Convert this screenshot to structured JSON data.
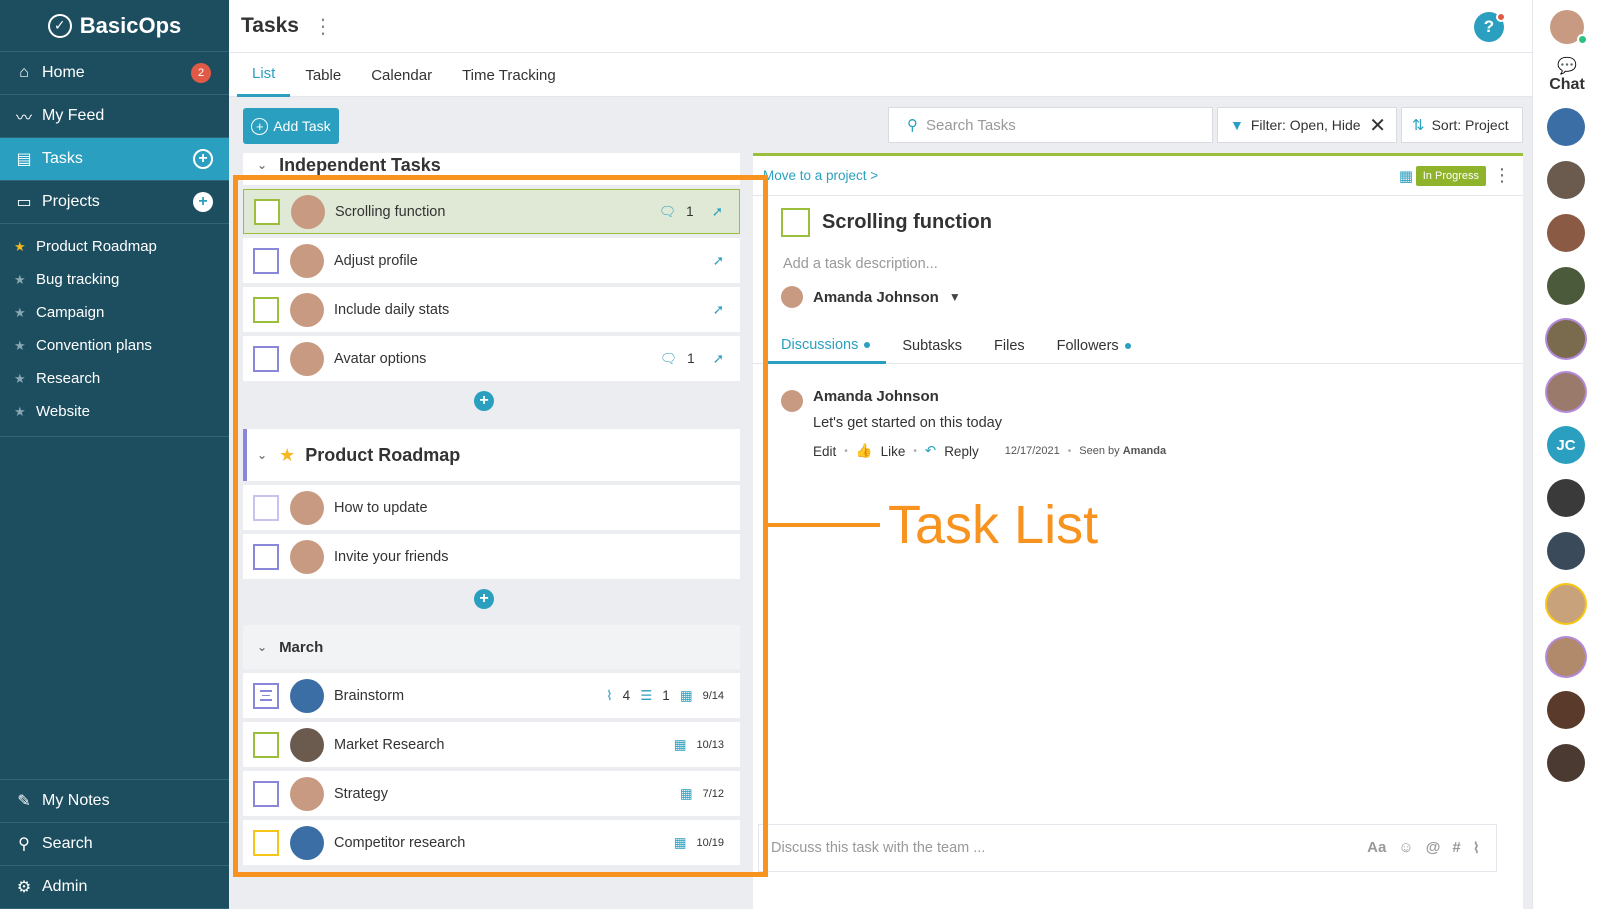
{
  "app": {
    "name": "BasicOps"
  },
  "sidebar": {
    "nav": [
      {
        "label": "Home",
        "icon": "home-icon",
        "glyph": "⌂",
        "badge": "2"
      },
      {
        "label": "My Feed",
        "icon": "pulse-icon",
        "glyph": "〰"
      },
      {
        "label": "Tasks",
        "icon": "clipboard-icon",
        "glyph": "▤"
      },
      {
        "label": "Projects",
        "icon": "folder-icon",
        "glyph": "▭"
      }
    ],
    "projects": [
      {
        "label": "Product Roadmap",
        "favorite": true
      },
      {
        "label": "Bug tracking",
        "favorite": false
      },
      {
        "label": "Campaign",
        "favorite": false
      },
      {
        "label": "Convention plans",
        "favorite": false
      },
      {
        "label": "Research",
        "favorite": false
      },
      {
        "label": "Website",
        "favorite": false
      }
    ],
    "bottom": [
      {
        "label": "My Notes",
        "icon": "pencil-icon",
        "glyph": "✎"
      },
      {
        "label": "Search",
        "icon": "search-icon",
        "glyph": "⚲"
      },
      {
        "label": "Admin",
        "icon": "gear-icon",
        "glyph": "⚙"
      }
    ]
  },
  "header": {
    "title": "Tasks",
    "help": "?"
  },
  "tabs": [
    {
      "label": "List",
      "active": true
    },
    {
      "label": "Table",
      "active": false
    },
    {
      "label": "Calendar",
      "active": false
    },
    {
      "label": "Time Tracking",
      "active": false
    }
  ],
  "toolbar": {
    "add_task": "Add Task",
    "search_placeholder": "Search Tasks",
    "filter_label": "Filter: Open, Hide",
    "sort_label": "Sort: Project"
  },
  "rail": {
    "chat_label": "Chat",
    "people": [
      {
        "bg": "#3a6ea5",
        "initials": ""
      },
      {
        "bg": "#6b5a4e",
        "initials": ""
      },
      {
        "bg": "#8a5a44",
        "initials": ""
      },
      {
        "bg": "#4a5a3a",
        "initials": ""
      },
      {
        "bg": "#7a6a4e",
        "initials": ""
      },
      {
        "bg": "#9a7a6a",
        "initials": ""
      },
      {
        "bg": "#2b9fbf",
        "initials": "JC"
      },
      {
        "bg": "#3a3a3a",
        "initials": ""
      },
      {
        "bg": "#3a4a5a",
        "initials": ""
      },
      {
        "bg": "#c8a27a",
        "initials": ""
      },
      {
        "bg": "#b08a6a",
        "initials": ""
      },
      {
        "bg": "#5a3a2a",
        "initials": ""
      },
      {
        "bg": "#4a3a32",
        "initials": ""
      }
    ]
  },
  "task_list": {
    "sections": [
      {
        "title": "Independent Tasks",
        "tasks": [
          {
            "name": "Scrolling function",
            "comments": "1",
            "selected": true,
            "box": "green"
          },
          {
            "name": "Adjust profile",
            "box": "purple"
          },
          {
            "name": "Include daily stats",
            "box": "green"
          },
          {
            "name": "Avatar options",
            "comments": "1",
            "box": "purple"
          }
        ]
      },
      {
        "title": "Product Roadmap",
        "tasks": [
          {
            "name": "How to update",
            "box": "light"
          },
          {
            "name": "Invite your friends",
            "box": "purple"
          }
        ]
      },
      {
        "title": "March",
        "tasks": [
          {
            "name": "Brainstorm",
            "attachments": "4",
            "subtasks": "1",
            "due": "9/14",
            "box": "lines"
          },
          {
            "name": "Market Research",
            "due": "10/13",
            "box": "green"
          },
          {
            "name": "Strategy",
            "due": "7/12",
            "box": "purple"
          },
          {
            "name": "Competitor research",
            "due": "10/19",
            "box": "yellow"
          }
        ]
      }
    ]
  },
  "detail": {
    "move_link": "Move to a project >",
    "status": "In Progress",
    "title": "Scrolling function",
    "description_placeholder": "Add a task description...",
    "assignee": "Amanda Johnson",
    "tabs": [
      {
        "label": "Discussions",
        "active": true,
        "dot": true
      },
      {
        "label": "Subtasks",
        "active": false,
        "dot": false
      },
      {
        "label": "Files",
        "active": false,
        "dot": false
      },
      {
        "label": "Followers",
        "active": false,
        "dot": true
      }
    ],
    "comment": {
      "author": "Amanda Johnson",
      "text": "Let's get started on this today",
      "edit": "Edit",
      "like": "Like",
      "reply": "Reply",
      "date": "12/17/2021",
      "seen_prefix": "Seen by",
      "seen_by": "Amanda"
    },
    "discuss_placeholder": "Discuss this task with the team ...",
    "composer_tools": [
      "Aa",
      "☺",
      "@",
      "#",
      "⌇"
    ]
  },
  "annotation": {
    "label": "Task List",
    "color": "#f7931e"
  }
}
